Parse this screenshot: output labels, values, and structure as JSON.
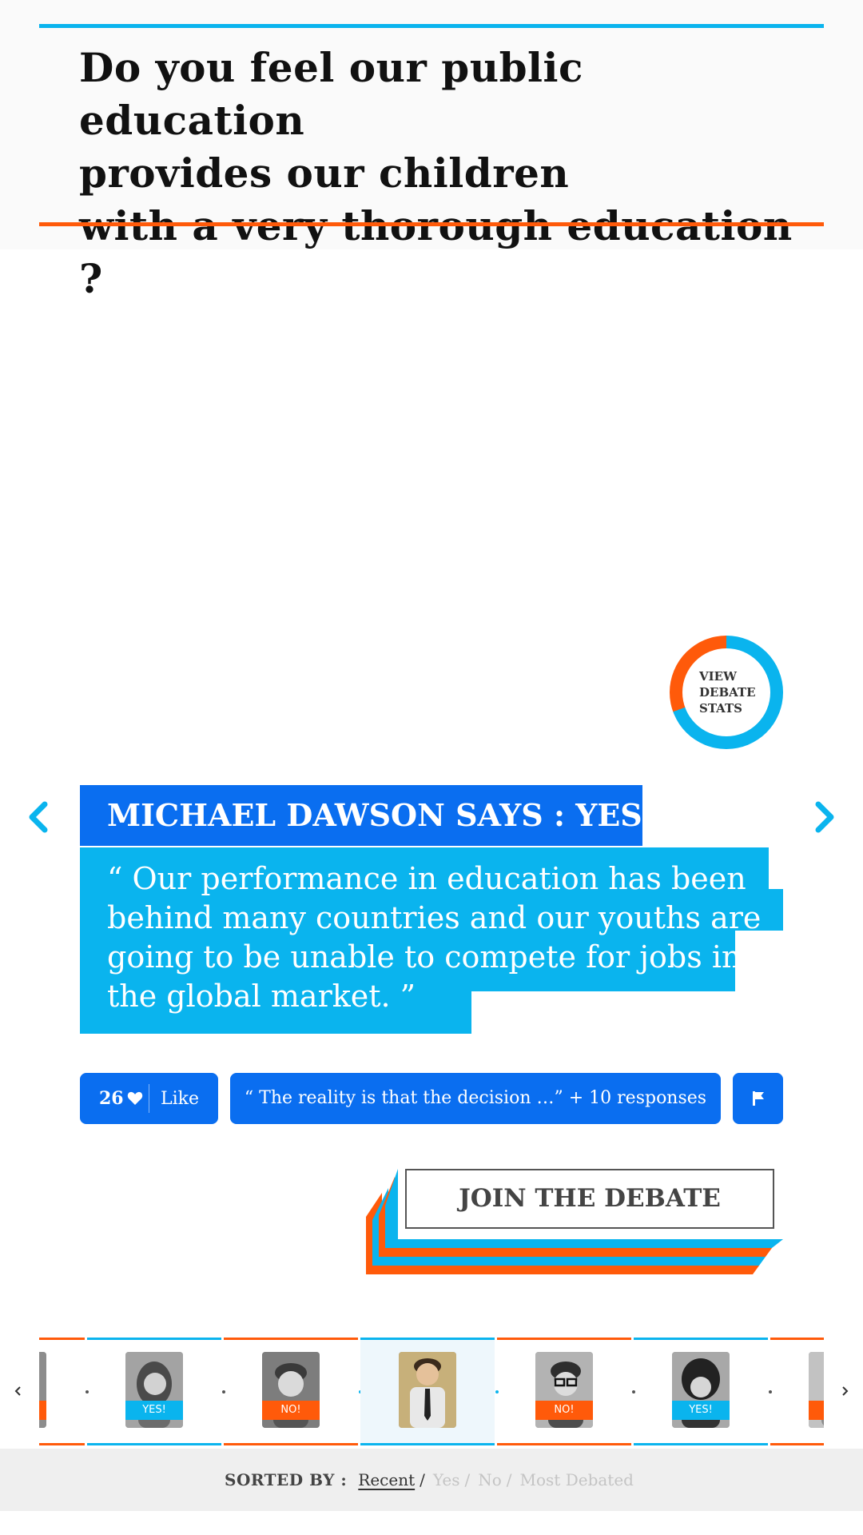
{
  "question": {
    "line1": "Do you feel our public education",
    "line2": "provides our children",
    "line3": "with a very thorough education ?"
  },
  "stats": {
    "line1": "VIEW",
    "line2": "DEBATE",
    "line3": "STATS"
  },
  "argument": {
    "says": "MICHAEL DAWSON SAYS : YES!",
    "quote": "“ Our performance in education has been behind many countries and our youths are going to be unable to compete for jobs in the global market. ”"
  },
  "actions": {
    "like_count": "26",
    "like_label": "Like",
    "responses": "“ The reality is that the decision …” + 10 responses"
  },
  "join_label": "JOIN THE DEBATE",
  "carousel": {
    "items": [
      {
        "badge": "",
        "badge_color": "#ff5a0a"
      },
      {
        "badge": "YES!",
        "badge_color": "#0ab4ee"
      },
      {
        "badge": "NO!",
        "badge_color": "#ff5a0a"
      },
      {
        "badge": "",
        "badge_color": "#0ab4ee"
      },
      {
        "badge": "NO!",
        "badge_color": "#ff5a0a"
      },
      {
        "badge": "YES!",
        "badge_color": "#0ab4ee"
      },
      {
        "badge": "",
        "badge_color": "#ff5a0a"
      }
    ]
  },
  "sort": {
    "label": "SORTED BY :",
    "options": [
      "Recent",
      "Yes",
      "No",
      "Most Debated"
    ],
    "separator": "/",
    "active": "Recent"
  },
  "colors": {
    "blue": "#0ab4ee",
    "dark_blue": "#0a6ef0",
    "orange": "#ff5a0a"
  }
}
